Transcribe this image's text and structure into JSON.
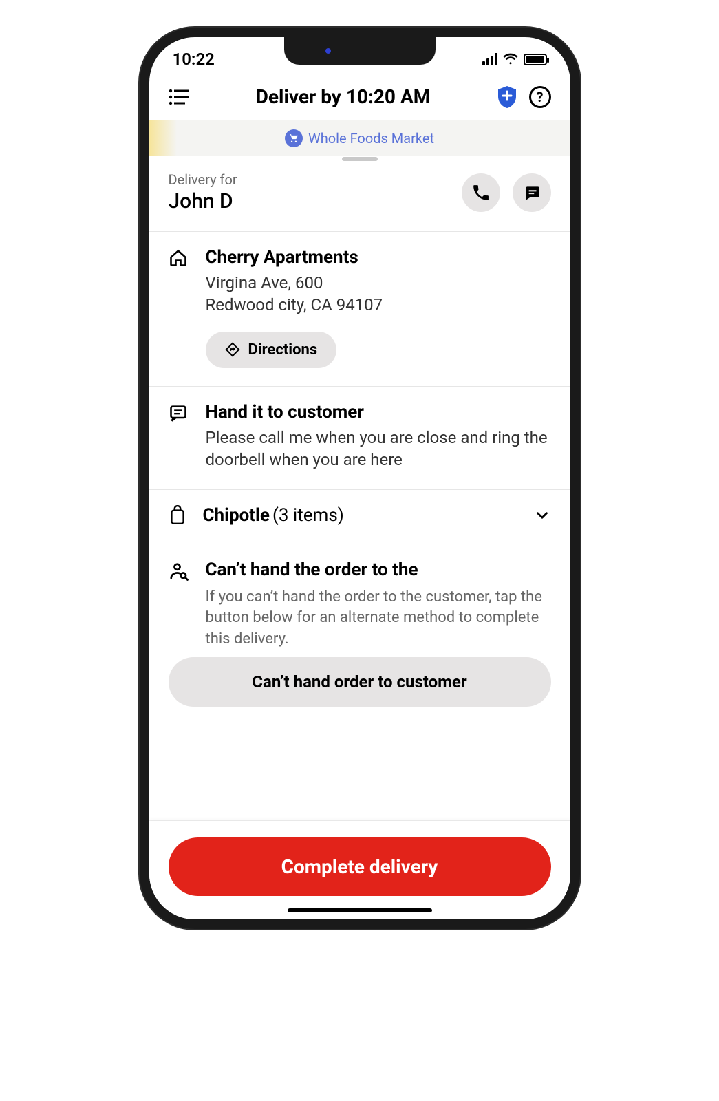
{
  "status_bar": {
    "time": "10:22"
  },
  "app_bar": {
    "title": "Deliver by 10:20 AM"
  },
  "map": {
    "poi_label": "Whole Foods Market"
  },
  "customer": {
    "label": "Delivery for",
    "name": "John D"
  },
  "address": {
    "name": "Cherry Apartments",
    "line1": "Virgina Ave, 600",
    "line2": "Redwood city, CA 94107",
    "directions_label": "Directions"
  },
  "instructions": {
    "heading": "Hand it to customer",
    "body": "Please call me when you are close and ring the doorbell when you are here"
  },
  "order": {
    "merchant": "Chipotle",
    "count_label": "(3 items)"
  },
  "alternate": {
    "heading": "Can’t hand the order to the",
    "body": "If you can’t hand the order to the customer, tap the button below for an alternate method to complete this delivery.",
    "button_label": "Can’t hand order to customer"
  },
  "footer": {
    "primary_label": "Complete delivery"
  }
}
